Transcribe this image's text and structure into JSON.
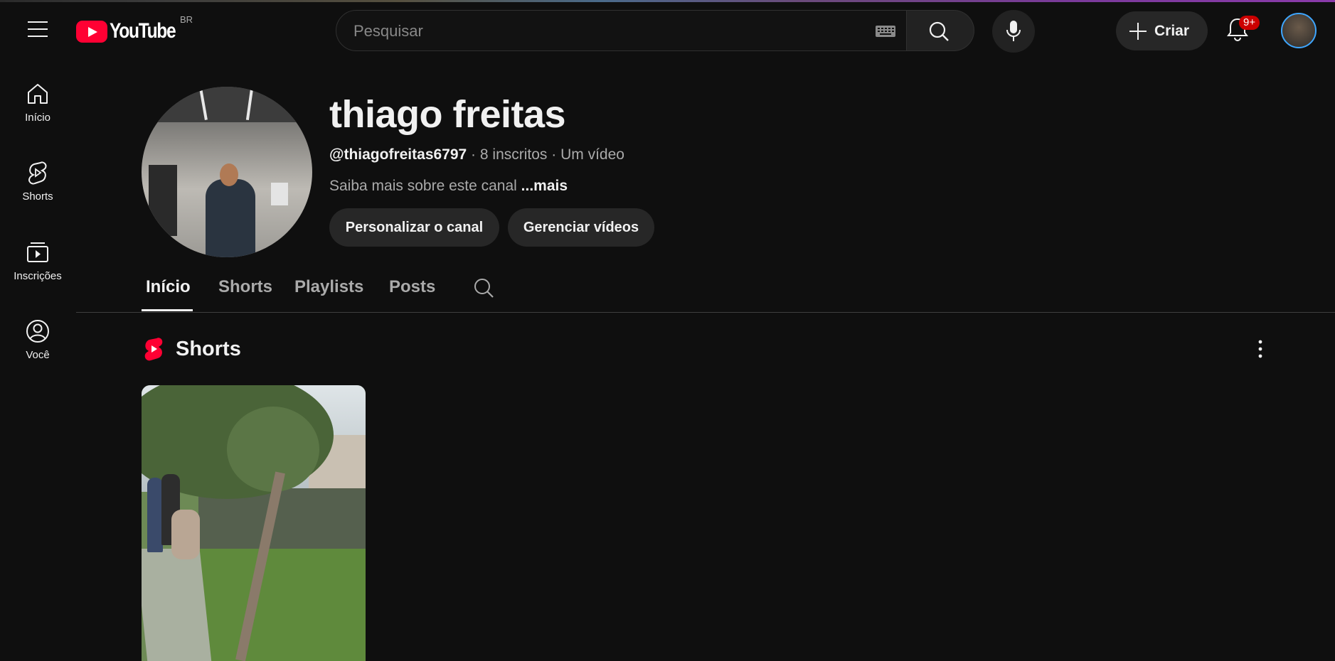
{
  "header": {
    "logo_text": "YouTube",
    "country_code": "BR",
    "search_placeholder": "Pesquisar",
    "create_label": "Criar",
    "notifications_badge": "9+"
  },
  "sidebar": {
    "items": [
      {
        "label": "Início",
        "icon": "home-icon"
      },
      {
        "label": "Shorts",
        "icon": "shorts-icon"
      },
      {
        "label": "Inscrições",
        "icon": "subscriptions-icon"
      },
      {
        "label": "Você",
        "icon": "account-icon"
      }
    ]
  },
  "channel": {
    "name": "thiago freitas",
    "handle": "@thiagofreitas6797",
    "separator": " · ",
    "subscribers": "8 inscritos",
    "videos": "Um vídeo",
    "about": "Saiba mais sobre este canal",
    "more": "...mais",
    "customize_label": "Personalizar o canal",
    "manage_label": "Gerenciar vídeos"
  },
  "tabs": [
    {
      "label": "Início",
      "active": true
    },
    {
      "label": "Shorts",
      "active": false
    },
    {
      "label": "Playlists",
      "active": false
    },
    {
      "label": "Posts",
      "active": false
    }
  ],
  "section": {
    "title": "Shorts"
  },
  "colors": {
    "background": "#0f0f0f",
    "brand_red": "#ff0033",
    "badge_red": "#cc0000",
    "pill_bg": "#272727"
  }
}
